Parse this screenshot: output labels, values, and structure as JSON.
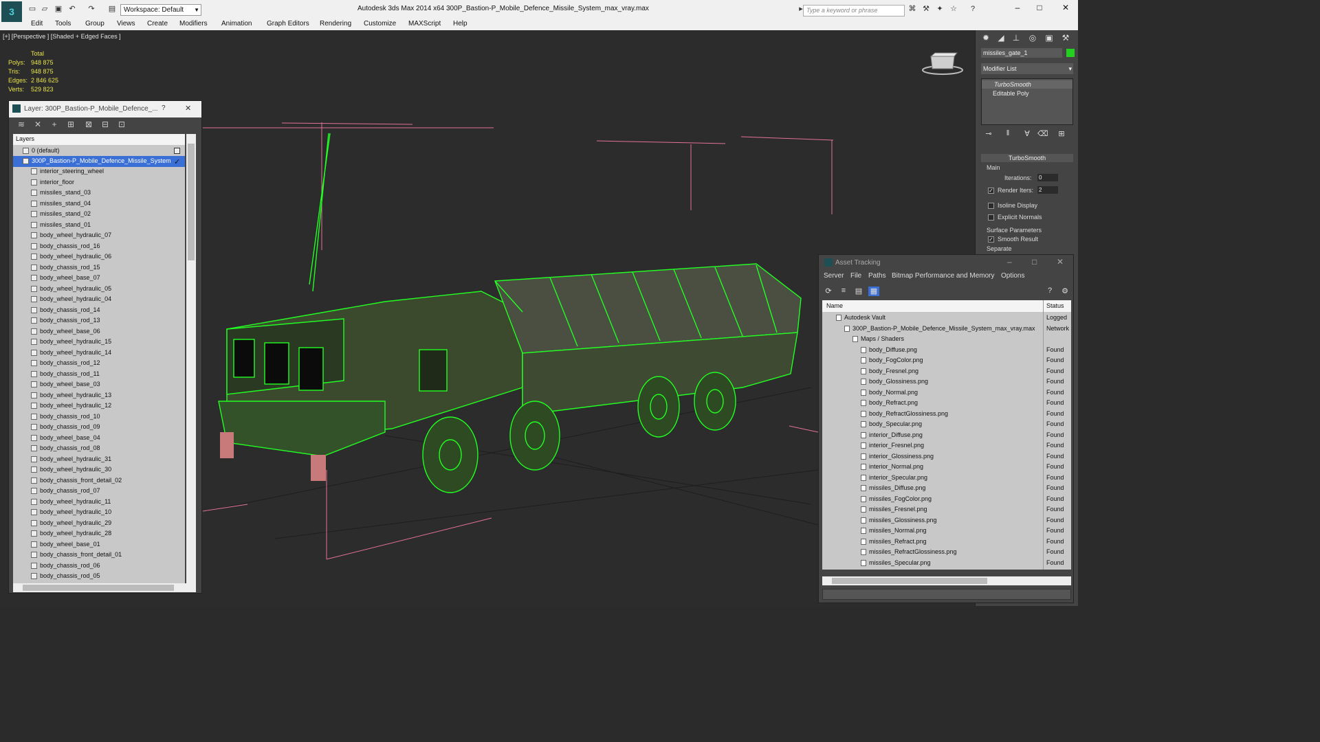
{
  "app": {
    "title": "Autodesk 3ds Max  2014 x64      300P_Bastion-P_Mobile_Defence_Missile_System_max_vray.max",
    "workspace": "Workspace: Default",
    "search_placeholder": "Type a keyword or phrase"
  },
  "menu": [
    "Edit",
    "Tools",
    "Group",
    "Views",
    "Create",
    "Modifiers",
    "Animation",
    "Graph Editors",
    "Rendering",
    "Customize",
    "MAXScript",
    "Help"
  ],
  "viewport": {
    "label": "[+] [Perspective ] [Shaded + Edged Faces ]",
    "stats": {
      "total_label": "Total",
      "rows": [
        {
          "label": "Polys:",
          "value": "948 875"
        },
        {
          "label": "Tris:",
          "value": "948 875"
        },
        {
          "label": "Edges:",
          "value": "2 846 625"
        },
        {
          "label": "Verts:",
          "value": "529 823"
        }
      ]
    },
    "wire_color": "#22ff22",
    "bg_color": "#2c2c2c"
  },
  "layer_explorer": {
    "title": "Layer: 300P_Bastion-P_Mobile_Defence_...",
    "help": "?",
    "close": "✕",
    "header": "Layers",
    "default_layer": "0 (default)",
    "active_layer": "300P_Bastion-P_Mobile_Defence_Missile_System",
    "items": [
      "interior_steering_wheel",
      "interior_floor",
      "missiles_stand_03",
      "missiles_stand_04",
      "missiles_stand_02",
      "missiles_stand_01",
      "body_wheel_hydraulic_07",
      "body_chassis_rod_16",
      "body_wheel_hydraulic_06",
      "body_chassis_rod_15",
      "body_wheel_base_07",
      "body_wheel_hydraulic_05",
      "body_wheel_hydraulic_04",
      "body_chassis_rod_14",
      "body_chassis_rod_13",
      "body_wheel_base_06",
      "body_wheel_hydraulic_15",
      "body_wheel_hydraulic_14",
      "body_chassis_rod_12",
      "body_chassis_rod_11",
      "body_wheel_base_03",
      "body_wheel_hydraulic_13",
      "body_wheel_hydraulic_12",
      "body_chassis_rod_10",
      "body_chassis_rod_09",
      "body_wheel_base_04",
      "body_chassis_rod_08",
      "body_wheel_hydraulic_31",
      "body_wheel_hydraulic_30",
      "body_chassis_front_detail_02",
      "body_chassis_rod_07",
      "body_wheel_hydraulic_11",
      "body_wheel_hydraulic_10",
      "body_wheel_hydraulic_29",
      "body_wheel_hydraulic_28",
      "body_wheel_base_01",
      "body_chassis_front_detail_01",
      "body_chassis_rod_06",
      "body_chassis_rod_05"
    ]
  },
  "command_panel": {
    "object_name": "missiles_gate_1",
    "object_color": "#22d11e",
    "modifier_list": "Modifier List",
    "stack": [
      "TurboSmooth",
      "Editable Poly"
    ],
    "rollout": "TurboSmooth",
    "main_label": "Main",
    "iterations_label": "Iterations:",
    "iterations": "0",
    "render_iters_label": "Render Iters:",
    "render_iters": "2",
    "isoline": "Isoline Display",
    "explicit_normals": "Explicit Normals",
    "surface_params": "Surface Parameters",
    "smooth_result": "Smooth Result",
    "separate": "Separate"
  },
  "asset_tracking": {
    "title": "Asset Tracking",
    "menu": [
      "Server",
      "File",
      "Paths",
      "Bitmap Performance and Memory",
      "Options"
    ],
    "col_name": "Name",
    "col_status": "Status",
    "rows": [
      {
        "name": "Autodesk Vault",
        "status": "Logged",
        "indent": 1
      },
      {
        "name": "300P_Bastion-P_Mobile_Defence_Missile_System_max_vray.max",
        "status": "Network",
        "indent": 2
      },
      {
        "name": "Maps / Shaders",
        "status": "",
        "indent": 3
      },
      {
        "name": "body_Diffuse.png",
        "status": "Found",
        "indent": 4
      },
      {
        "name": "body_FogColor.png",
        "status": "Found",
        "indent": 4
      },
      {
        "name": "body_Fresnel.png",
        "status": "Found",
        "indent": 4
      },
      {
        "name": "body_Glossiness.png",
        "status": "Found",
        "indent": 4
      },
      {
        "name": "body_Normal.png",
        "status": "Found",
        "indent": 4
      },
      {
        "name": "body_Refract.png",
        "status": "Found",
        "indent": 4
      },
      {
        "name": "body_RefractGlossiness.png",
        "status": "Found",
        "indent": 4
      },
      {
        "name": "body_Specular.png",
        "status": "Found",
        "indent": 4
      },
      {
        "name": "interior_Diffuse.png",
        "status": "Found",
        "indent": 4
      },
      {
        "name": "interior_Fresnel.png",
        "status": "Found",
        "indent": 4
      },
      {
        "name": "interior_Glossiness.png",
        "status": "Found",
        "indent": 4
      },
      {
        "name": "interior_Normal.png",
        "status": "Found",
        "indent": 4
      },
      {
        "name": "interior_Specular.png",
        "status": "Found",
        "indent": 4
      },
      {
        "name": "missiles_Diffuse.png",
        "status": "Found",
        "indent": 4
      },
      {
        "name": "missiles_FogColor.png",
        "status": "Found",
        "indent": 4
      },
      {
        "name": "missiles_Fresnel.png",
        "status": "Found",
        "indent": 4
      },
      {
        "name": "missiles_Glossiness.png",
        "status": "Found",
        "indent": 4
      },
      {
        "name": "missiles_Normal.png",
        "status": "Found",
        "indent": 4
      },
      {
        "name": "missiles_Refract.png",
        "status": "Found",
        "indent": 4
      },
      {
        "name": "missiles_RefractGlossiness.png",
        "status": "Found",
        "indent": 4
      },
      {
        "name": "missiles_Specular.png",
        "status": "Found",
        "indent": 4
      }
    ]
  }
}
